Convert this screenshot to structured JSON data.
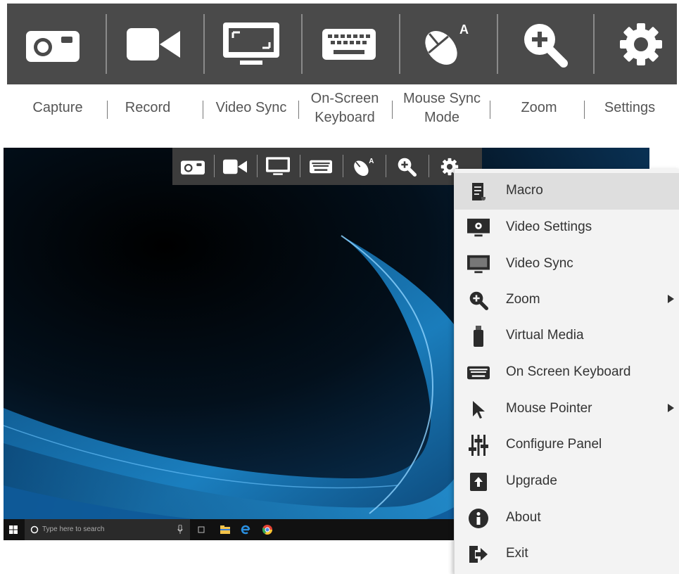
{
  "toolbar": {
    "buttons": [
      {
        "label": "Capture",
        "icon": "camera-icon"
      },
      {
        "label": "Record",
        "icon": "video-camera-icon"
      },
      {
        "label": "Video Sync",
        "icon": "monitor-icon"
      },
      {
        "label_line1": "On-Screen",
        "label_line2": "Keyboard",
        "icon": "keyboard-icon"
      },
      {
        "label_line1": "Mouse Sync",
        "label_line2": "Mode",
        "icon": "mouse-icon",
        "badge": "A"
      },
      {
        "label": "Zoom",
        "icon": "zoom-in-icon"
      },
      {
        "label": "Settings",
        "icon": "gear-icon"
      }
    ]
  },
  "taskbar": {
    "search_placeholder": "Type here to search"
  },
  "mini_toolbar": {
    "mouse_badge": "A"
  },
  "menu": {
    "items": [
      {
        "label": "Macro",
        "icon": "macro-icon",
        "highlighted": true,
        "submenu": false
      },
      {
        "label": "Video Settings",
        "icon": "video-settings-icon",
        "submenu": false
      },
      {
        "label": "Video Sync",
        "icon": "monitor-icon",
        "submenu": false
      },
      {
        "label": "Zoom",
        "icon": "zoom-in-icon",
        "submenu": true
      },
      {
        "label": "Virtual Media",
        "icon": "usb-drive-icon",
        "submenu": false
      },
      {
        "label": "On Screen Keyboard",
        "icon": "keyboard-icon",
        "submenu": false
      },
      {
        "label": "Mouse Pointer",
        "icon": "cursor-icon",
        "submenu": true
      },
      {
        "label": "Configure Panel",
        "icon": "sliders-icon",
        "submenu": false
      },
      {
        "label": "Upgrade",
        "icon": "upgrade-icon",
        "submenu": false
      },
      {
        "label": "About",
        "icon": "info-icon",
        "submenu": false
      },
      {
        "label": "Exit",
        "icon": "exit-icon",
        "submenu": false
      }
    ]
  },
  "colors": {
    "toolbar_bg": "#4a4a4a",
    "icon_fill": "#ffffff",
    "menu_bg": "#f3f3f3",
    "menu_highlight": "#dedede",
    "wallpaper_accent": "#1a8ad4"
  }
}
